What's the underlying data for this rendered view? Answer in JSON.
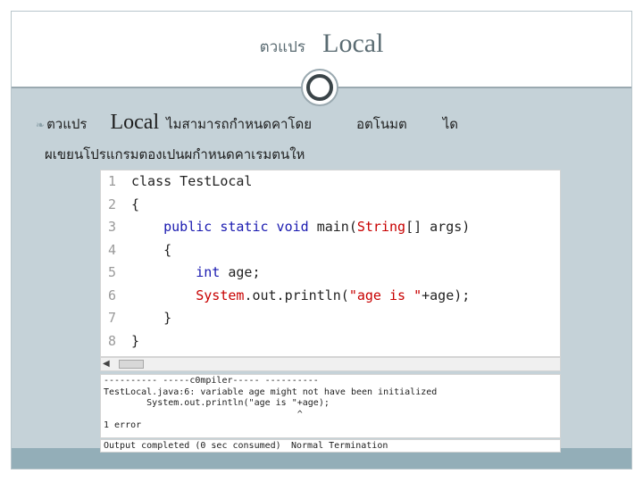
{
  "slide": {
    "title_thai": "ตวแปร",
    "title_en": "Local",
    "bullet_line1": {
      "word1": "ตวแปร",
      "word_local": "Local",
      "text_a": "ไมสามารถกำหนดคาโดย",
      "text_b": "อตโนมต",
      "text_c": "ได"
    },
    "bullet_line2": "ผเขยนโปรแกรมตองเปนผกำหนดคาเรมตนให"
  },
  "editor": {
    "lines": [
      {
        "num": "1",
        "indent": "",
        "tokens": [
          {
            "t": "class TestLocal",
            "c": "plain"
          }
        ]
      },
      {
        "num": "2",
        "indent": "",
        "tokens": [
          {
            "t": "{",
            "c": "plain"
          }
        ]
      },
      {
        "num": "3",
        "indent": "",
        "tokens": [
          {
            "t": "    public static void ",
            "c": "kw"
          },
          {
            "t": "main(",
            "c": "plain"
          },
          {
            "t": "String",
            "c": "str"
          },
          {
            "t": "[] args)",
            "c": "plain"
          }
        ]
      },
      {
        "num": "4",
        "indent": "",
        "tokens": [
          {
            "t": "    {",
            "c": "plain"
          }
        ]
      },
      {
        "num": "5",
        "indent": "",
        "tokens": [
          {
            "t": "        int ",
            "c": "kw"
          },
          {
            "t": "age;",
            "c": "plain"
          }
        ]
      },
      {
        "num": "6",
        "indent": "",
        "tokens": [
          {
            "t": "        System",
            "c": "str"
          },
          {
            "t": ".out.println(",
            "c": "plain"
          },
          {
            "t": "\"age is \"",
            "c": "str"
          },
          {
            "t": "+age);",
            "c": "plain"
          }
        ]
      },
      {
        "num": "7",
        "indent": "",
        "tokens": [
          {
            "t": "    }",
            "c": "plain"
          }
        ]
      },
      {
        "num": "8",
        "indent": "",
        "tokens": [
          {
            "t": "}",
            "c": "plain"
          }
        ]
      }
    ]
  },
  "output": {
    "lines": [
      "---------- -----c0mpiler----- ----------",
      "TestLocal.java:6: variable age might not have been initialized",
      "        System.out.println(\"age is \"+age);",
      "                                    ^",
      "1 error"
    ]
  },
  "status": {
    "left": "Output completed (0 sec consumed)",
    "right": "Normal Termination"
  },
  "colors": {
    "content_bg": "#c5d2d8",
    "bottom_band": "#93aeb8",
    "keyword": "#1a1ab0",
    "string": "#c80000"
  }
}
